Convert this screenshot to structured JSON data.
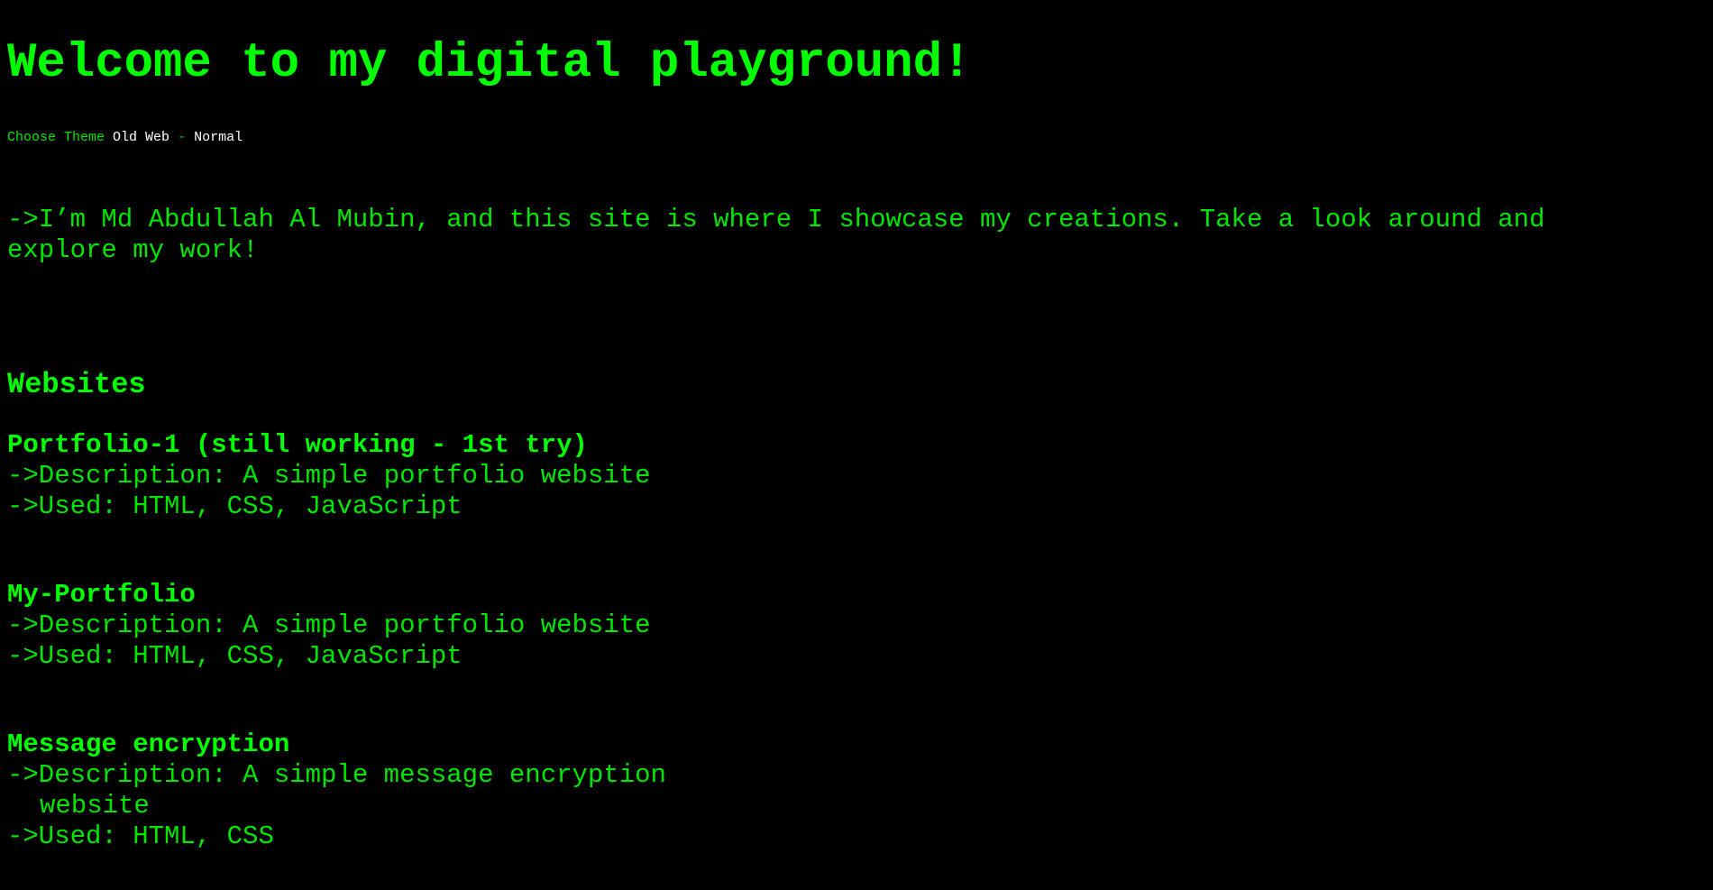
{
  "header": {
    "title": "Welcome to my digital playground!"
  },
  "theme": {
    "label": "Choose Theme",
    "selected": "Old Web",
    "separator": "-",
    "alternative": "Normal"
  },
  "intro": {
    "text": "->I’m Md Abdullah Al Mubin, and this site is where I showcase my creations. Take a look around and explore my work!"
  },
  "websites": {
    "heading": "Websites",
    "projects": [
      {
        "title": "Portfolio-1 (still working - 1st try)",
        "description": "->Description: A simple portfolio website",
        "used": "->Used: HTML, CSS, JavaScript"
      },
      {
        "title": "My-Portfolio",
        "description": "->Description: A simple portfolio website",
        "used": "->Used: HTML, CSS, JavaScript"
      },
      {
        "title": "Message encryption",
        "description": "->Description: A simple message encryption",
        "description_cont": "website",
        "used": "->Used: HTML, CSS"
      }
    ]
  },
  "colors": {
    "background": "#000000",
    "text": "#00e600",
    "heading": "#00ff00",
    "theme_value": "#ffffff"
  }
}
